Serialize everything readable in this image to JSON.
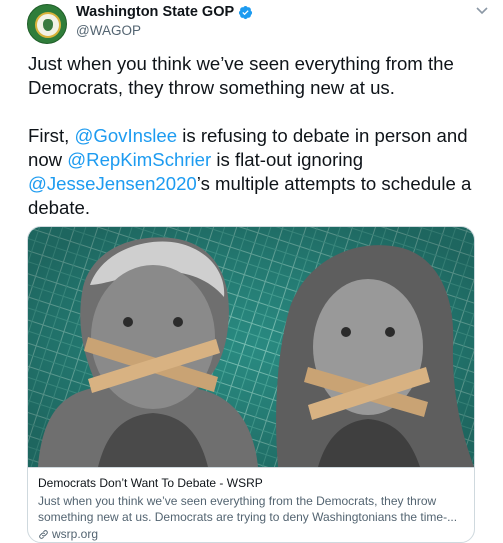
{
  "account": {
    "display_name": "Washington State GOP",
    "handle": "@WAGOP"
  },
  "tweet": {
    "paragraph1": "Just when you think we’ve seen everything from the Democrats, they throw something new at us.",
    "p2_part1": "First, ",
    "mention1": "@GovInslee",
    "p2_part2": " is refusing to debate in person and now ",
    "mention2": "@RepKimSchrier",
    "p2_part3": " is flat-out ignoring ",
    "mention3": "@JesseJensen2020",
    "p2_part4": "’s multiple attempts to schedule a debate."
  },
  "card": {
    "title": "Democrats Don’t Want To Debate - WSRP",
    "description": "Just when you think we’ve seen everything from the Democrats, they throw something new at us. Democrats are trying to deny Washingtonians the time-...",
    "domain": "wsrp.org"
  },
  "colors": {
    "link": "#1d9bf0",
    "verified": "#1d9bf0",
    "image_background": "#3aa39a"
  },
  "icons": {
    "verified": "verified-badge-icon",
    "caret": "chevron-down-icon",
    "link": "link-icon"
  }
}
